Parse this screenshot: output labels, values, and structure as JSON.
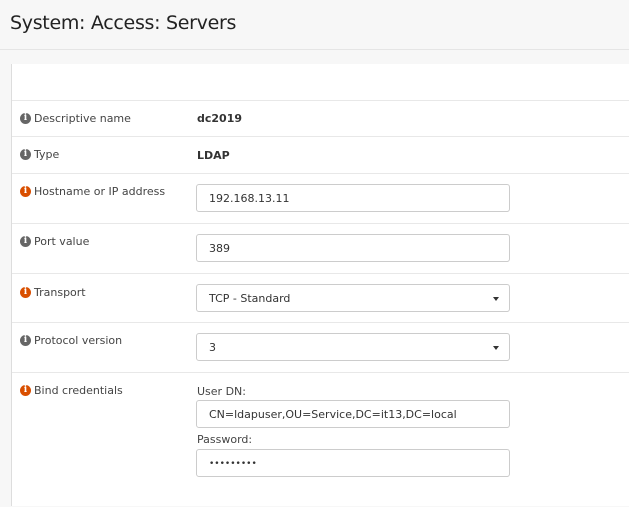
{
  "header": {
    "title": "System: Access: Servers"
  },
  "fields": {
    "descriptive_name": {
      "label": "Descriptive name",
      "value": "dc2019"
    },
    "type": {
      "label": "Type",
      "value": "LDAP"
    },
    "hostname": {
      "label": "Hostname or IP address",
      "value": "192.168.13.11"
    },
    "port": {
      "label": "Port value",
      "value": "389"
    },
    "transport": {
      "label": "Transport",
      "value": "TCP - Standard"
    },
    "protocol": {
      "label": "Protocol version",
      "value": "3"
    },
    "bind": {
      "label": "Bind credentials",
      "user_dn_label": "User DN:",
      "user_dn": "CN=ldapuser,OU=Service,DC=it13,DC=local",
      "password_label": "Password:",
      "password": "•••••••••"
    }
  },
  "colors": {
    "info_icon": "#666666",
    "required_icon": "#d94f00"
  }
}
